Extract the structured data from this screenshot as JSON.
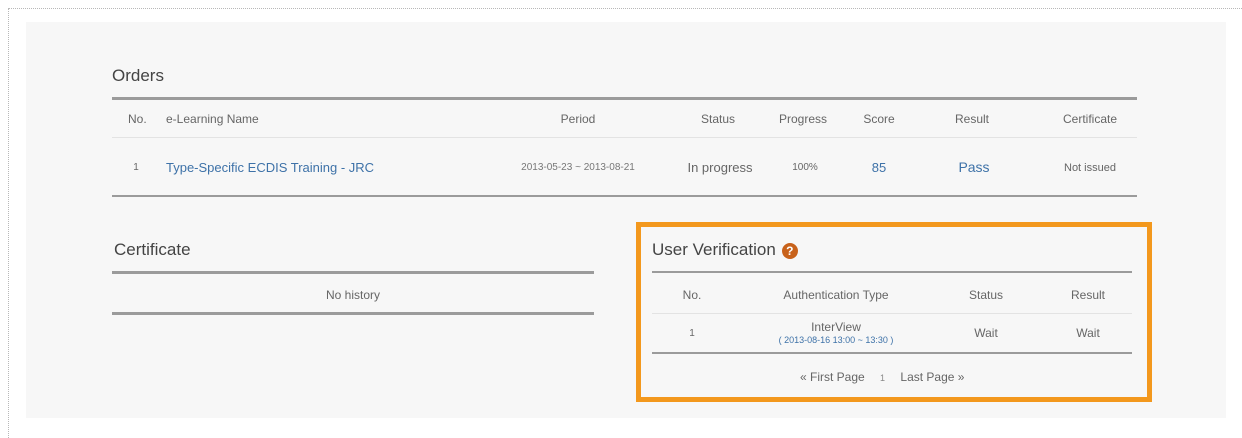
{
  "orders": {
    "title": "Orders",
    "headers": [
      "No.",
      "e-Learning Name",
      "Period",
      "Status",
      "Progress",
      "Score",
      "Result",
      "Certificate"
    ],
    "row": {
      "no": "1",
      "name": "Type-Specific ECDIS Training - JRC",
      "period": "2013-05-23 ~ 2013-08-21",
      "status": "In progress",
      "progress": "100%",
      "score": "85",
      "result": "Pass",
      "certificate": "Not issued"
    }
  },
  "certificate": {
    "title": "Certificate",
    "empty_text": "No history"
  },
  "verification": {
    "title": "User Verification",
    "help_icon": "?",
    "headers": [
      "No.",
      "Authentication Type",
      "Status",
      "Result"
    ],
    "row": {
      "no": "1",
      "type": "InterView",
      "schedule": "( 2013-08-16 13:00 ~ 13:30 )",
      "status": "Wait",
      "result": "Wait"
    },
    "pager": {
      "first": "« First Page",
      "page": "1",
      "last": "Last Page »"
    }
  },
  "colors": {
    "highlight_border": "#f3981d",
    "link": "#3e72a8",
    "help_icon_bg": "#c8621b"
  }
}
